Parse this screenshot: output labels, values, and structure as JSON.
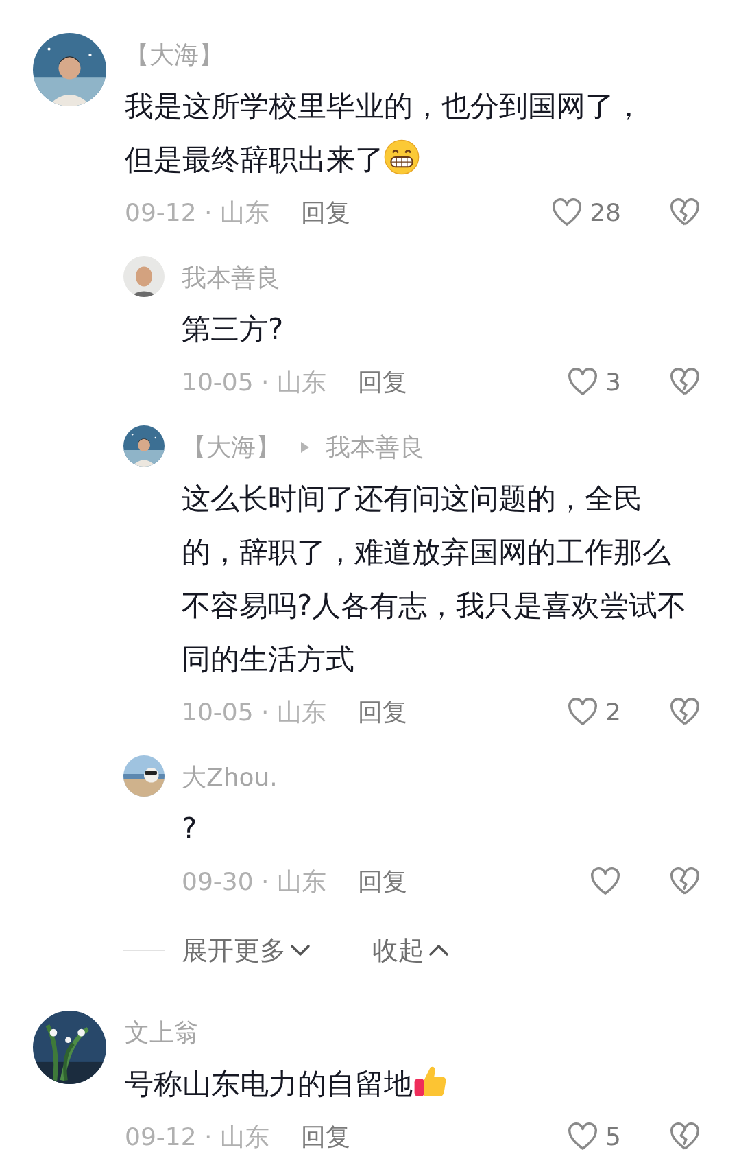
{
  "comments": [
    {
      "user": "【大海】",
      "text": "我是这所学校里毕业的，也分到国网了，但是最终辞职出来了",
      "emoji": {
        "kind": "grin"
      },
      "meta": "09-12 · 山东",
      "reply": "回复",
      "likes": "28",
      "replies": [
        {
          "user": "我本善良",
          "text": "第三方?",
          "meta": "10-05 · 山东",
          "reply": "回复",
          "likes": "3"
        },
        {
          "user": "【大海】",
          "reply_to": "我本善良",
          "text": "这么长时间了还有问这问题的，全民的，辞职了，难道放弃国网的工作那么不容易吗?人各有志，我只是喜欢尝试不同的生活方式",
          "meta": "10-05 · 山东",
          "reply": "回复",
          "likes": "2"
        },
        {
          "user": "大Zhou.",
          "text": "?",
          "meta": "09-30 · 山东",
          "reply": "回复"
        }
      ],
      "thread_controls": {
        "expand": "展开更多",
        "collapse": "收起"
      }
    },
    {
      "user": "文上翁",
      "text": "号称山东电力的自留地",
      "emoji": {
        "kind": "thumbs-up"
      },
      "meta": "09-12 · 山东",
      "reply": "回复",
      "likes": "5"
    }
  ]
}
